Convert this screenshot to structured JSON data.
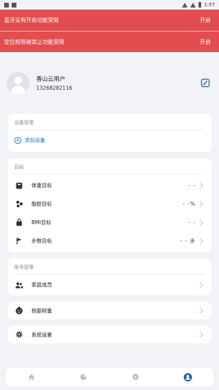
{
  "statusbar": {
    "time": "1:57"
  },
  "banners": [
    {
      "message": "蓝牙没有开启功能受限",
      "action": "开启"
    },
    {
      "message": "定位权限被禁止功能受限",
      "action": "开启"
    }
  ],
  "profile": {
    "username": "香山云用户",
    "phone": "13268282116"
  },
  "device_section": {
    "title": "设备管理",
    "add_label": "添加设备"
  },
  "goals_section": {
    "title": "目标",
    "items": [
      {
        "label": "体重目标",
        "value": "- -",
        "icon": "weight-icon"
      },
      {
        "label": "脂肪目标",
        "value": "- -%",
        "icon": "fat-icon"
      },
      {
        "label": "BMI目标",
        "value": "- -",
        "icon": "bmi-icon"
      },
      {
        "label": "步数目标",
        "value": "- - 步",
        "icon": "flag-icon"
      }
    ]
  },
  "account_section": {
    "title": "账号管理",
    "family_label": "家庭成员"
  },
  "baby_weigh_label": "抱婴称重",
  "settings_label": "系统设置",
  "tabs": [
    "home-icon",
    "stats-icon",
    "discover-icon",
    "profile-icon"
  ],
  "colors": {
    "banner": "#e24d4f",
    "accent": "#1e6fb8",
    "active_tab": "#1e5fa8",
    "inactive_tab": "#b8bdc8"
  }
}
